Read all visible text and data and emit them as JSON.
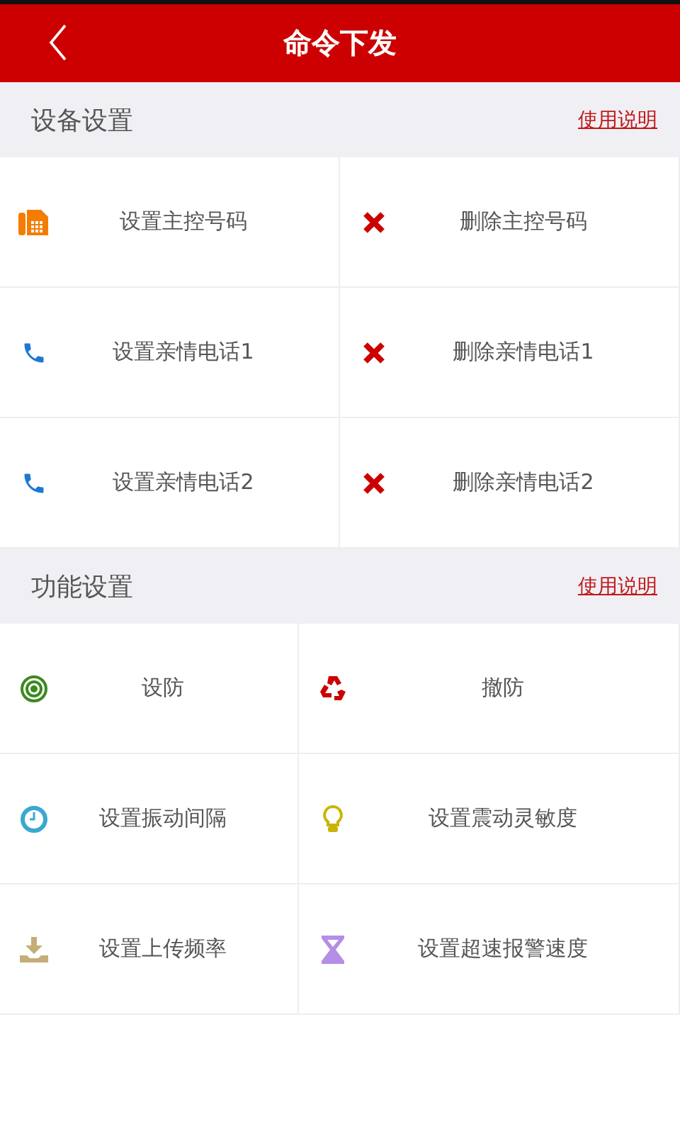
{
  "header": {
    "title": "命令下发"
  },
  "sections": [
    {
      "title": "设备设置",
      "help_link": "使用说明",
      "items": [
        {
          "kind": "fax",
          "label": "设置主控号码"
        },
        {
          "kind": "cross",
          "label": "删除主控号码"
        },
        {
          "kind": "phone",
          "label": "设置亲情电话1"
        },
        {
          "kind": "cross",
          "label": "删除亲情电话1"
        },
        {
          "kind": "phone",
          "label": "设置亲情电话2"
        },
        {
          "kind": "cross",
          "label": "删除亲情电话2"
        }
      ]
    },
    {
      "title": "功能设置",
      "help_link": "使用说明",
      "items": [
        {
          "kind": "target",
          "label": "设防"
        },
        {
          "kind": "recycle",
          "label": "撤防"
        },
        {
          "kind": "clock",
          "label": "设置振动间隔"
        },
        {
          "kind": "bulb",
          "label": "设置震动灵敏度"
        },
        {
          "kind": "download",
          "label": "设置上传频率"
        },
        {
          "kind": "hourglass",
          "label": "设置超速报警速度"
        }
      ]
    }
  ]
}
